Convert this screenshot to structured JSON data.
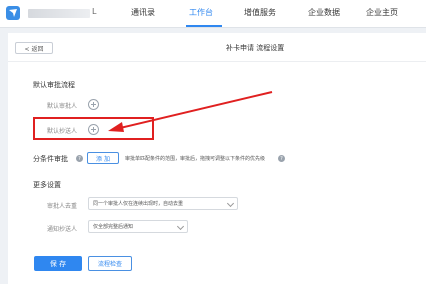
{
  "topnav": {
    "company_suffix": "L",
    "items": [
      "通讯录",
      "工作台",
      "增值服务",
      "企业数据",
      "企业主页"
    ],
    "active_index": 1
  },
  "header": {
    "back_label": "< 返回",
    "title": "补卡申请 流程设置"
  },
  "default_flow": {
    "title": "默认审批流程",
    "approver_label": "默认审批人",
    "cc_label": "默认抄送人"
  },
  "conditional": {
    "title": "分条件审批",
    "add_label": "添 加",
    "description": "审批单匹配条件的范围，审批后，拖拽可调整以下条件的优先级"
  },
  "more": {
    "title": "更多设置",
    "dedup_label": "审批人去重",
    "dedup_value": "同一个审批人仅在连续出现时，自动去重",
    "notify_label": "通知抄送人",
    "notify_value": "仅全部完整后通知"
  },
  "footer": {
    "save_label": "保 存",
    "check_label": "流程检查"
  },
  "colors": {
    "accent": "#2f87f0",
    "highlight": "#e02020"
  }
}
